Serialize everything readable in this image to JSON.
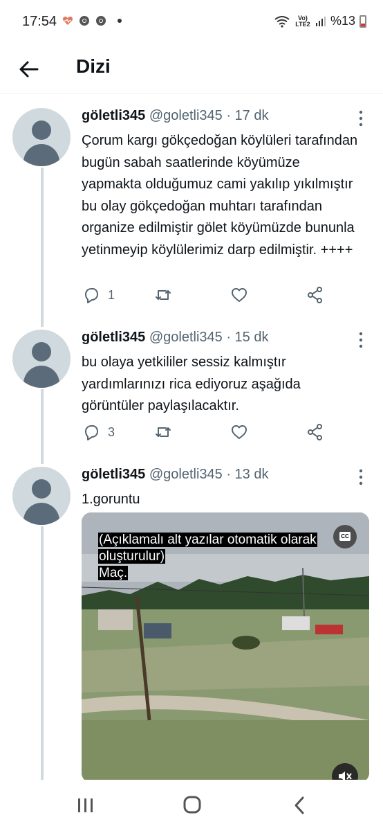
{
  "status_bar": {
    "time": "17:54",
    "network": "Vo) LTE2",
    "battery": "%13",
    "icons": [
      "heart-pulse-icon",
      "chrome-icon",
      "chrome-icon",
      "dot-icon",
      "wifi-icon",
      "signal-icon",
      "battery-icon"
    ]
  },
  "header": {
    "title": "Dizi",
    "back_icon": "arrow-left-icon"
  },
  "tweets": [
    {
      "name": "göletli345",
      "handle": "@goletli345",
      "time": "· 17 dk",
      "text": "Çorum kargı gökçedoğan köylüleri tarafından bugün sabah saatlerinde köyümüze yapmakta olduğumuz cami yakılıp yıkılmıştır bu olay gökçedoğan muhtarı tarafından organize edilmiştir gölet köyümüzde bununla yetinmeyip köylülerimiz darp edilmiştir. ++++",
      "replies": "1",
      "retweets": "",
      "likes": ""
    },
    {
      "name": "göletli345",
      "handle": "@goletli345",
      "time": "· 15 dk",
      "text": "bu olaya yetkililer sessiz kalmıştır yardımlarınızı rica ediyoruz aşağıda görüntüler paylaşılacaktır.",
      "replies": "3",
      "retweets": "",
      "likes": ""
    },
    {
      "name": "göletli345",
      "handle": "@goletli345",
      "time": "· 13 dk",
      "text": "1.goruntu",
      "media": {
        "captions": [
          "(Açıklamalı alt yazılar otomatik olarak",
          "oluşturulur)",
          "Maç."
        ],
        "cc_label": "CC"
      }
    }
  ],
  "colors": {
    "text_primary": "#0f1419",
    "text_secondary": "#536471",
    "thread_line": "#cfd9de",
    "avatar_bg": "#cfd9de",
    "avatar_fg": "#5b6b79"
  }
}
